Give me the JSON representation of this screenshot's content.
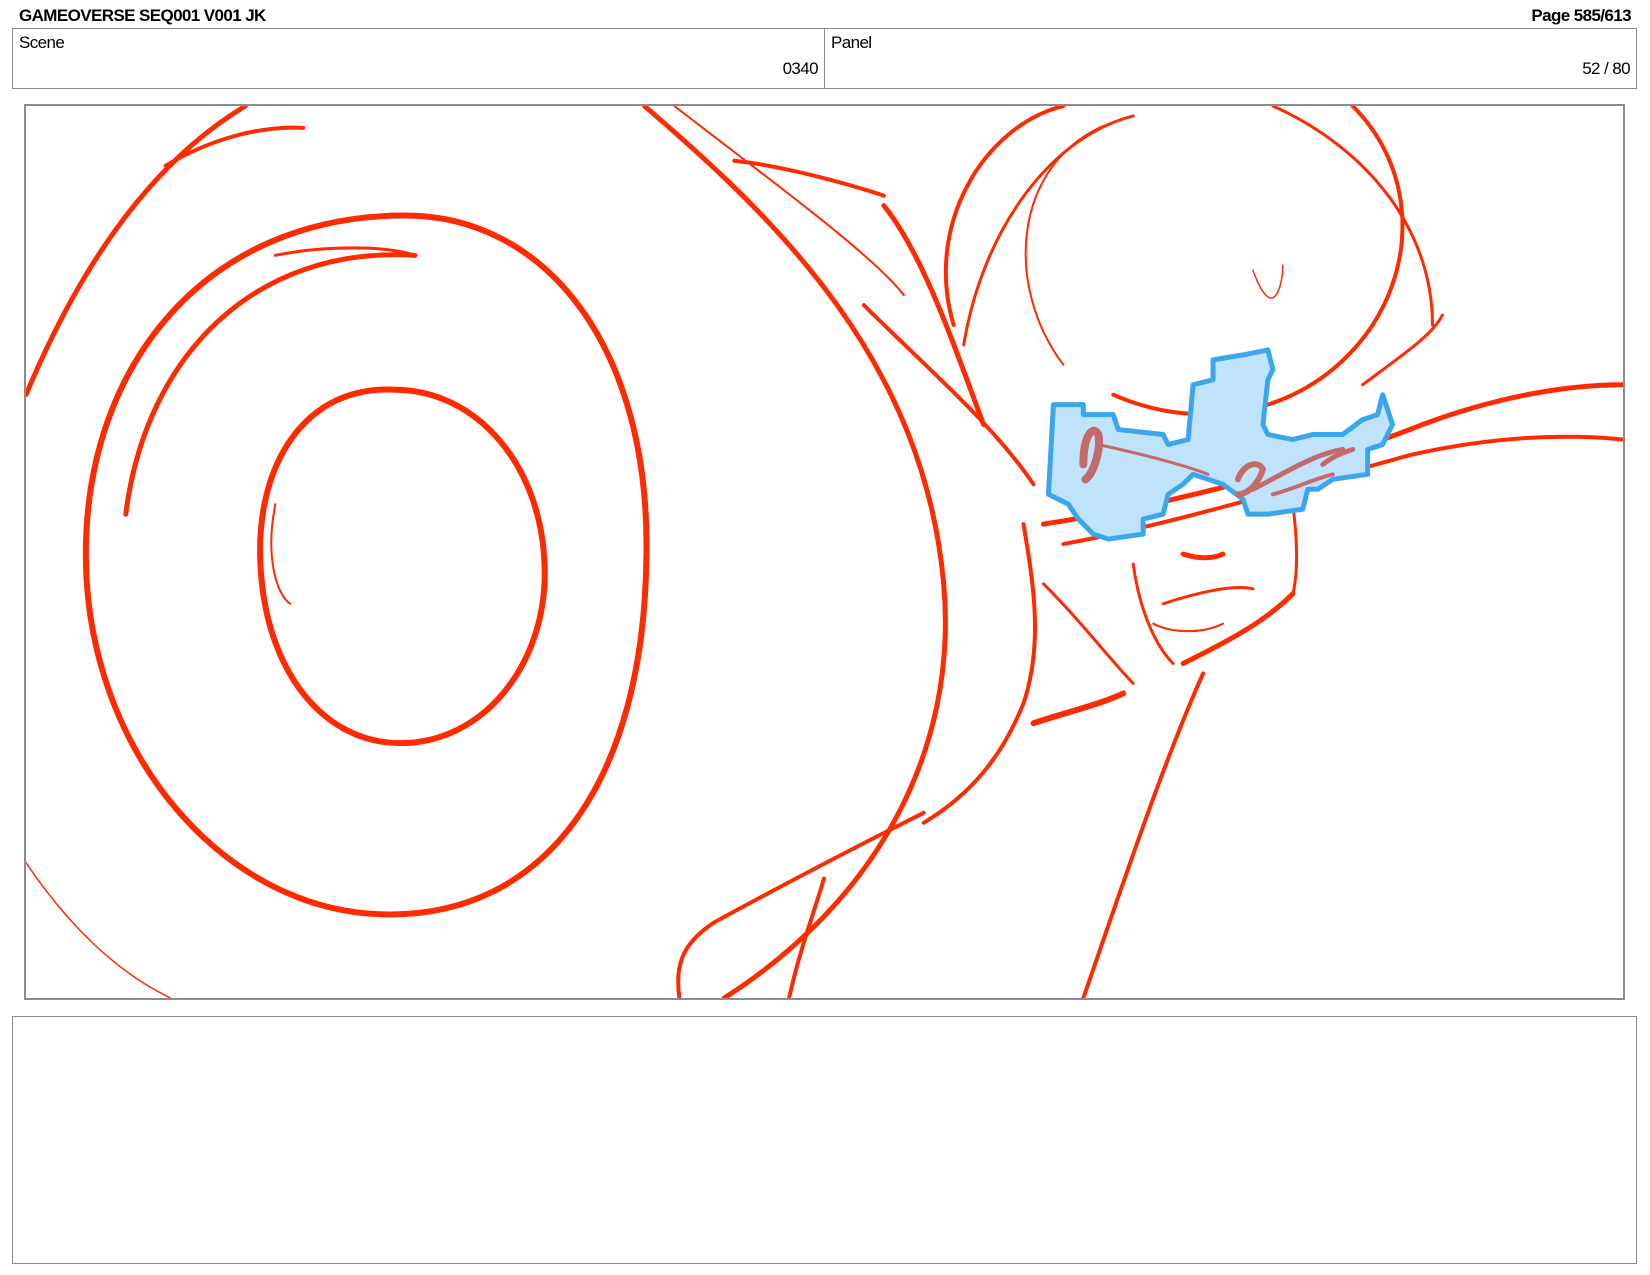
{
  "header": {
    "title": "GAMEOVERSE SEQ001 V001 JK",
    "page": "Page 585/613"
  },
  "info": {
    "scene_label": "Scene",
    "scene_value": "0340",
    "panel_label": "Panel",
    "panel_value": "52 / 80"
  },
  "colors": {
    "sketch_line": "#ff2a00",
    "glasses_fill": "#bfe3fb",
    "glasses_outline": "#3aa6ec",
    "glasses_sketch": "#c46a6a",
    "frame_border": "#8c8c8c"
  },
  "panel_image": {
    "subject": "storyboard-sketch"
  },
  "notes": {
    "text": ""
  }
}
